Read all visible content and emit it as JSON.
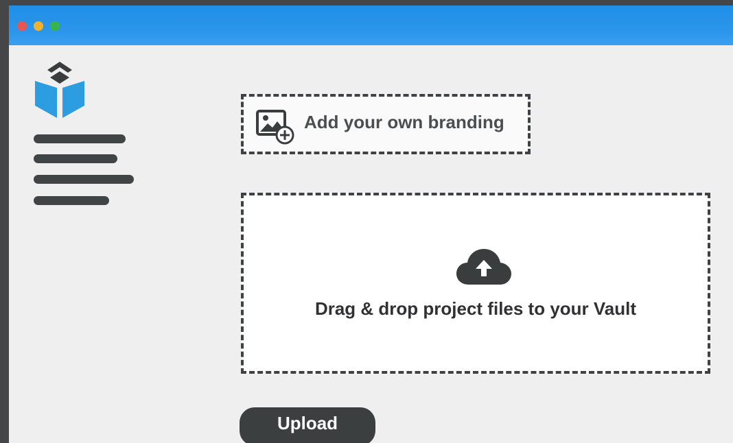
{
  "window": {
    "controls": [
      {
        "name": "close",
        "color": "#e8574f"
      },
      {
        "name": "minimize",
        "color": "#f3b12c"
      },
      {
        "name": "maximize",
        "color": "#38b54a"
      }
    ],
    "titlebar_color": "#2a95ea"
  },
  "sidebar": {
    "logo_icon": "cube-logo-icon",
    "logo_colors": {
      "primary": "#2b9de0",
      "dark": "#3a3d3e"
    },
    "menu_icon": "text-lines-icon"
  },
  "branding": {
    "label": "Add your own branding",
    "icon": "add-image-icon"
  },
  "dropzone": {
    "label": "Drag & drop project files to your Vault",
    "icon": "cloud-upload-icon"
  },
  "actions": {
    "upload_label": "Upload"
  },
  "colors": {
    "dark": "#3c3f40",
    "background": "#efeff0"
  }
}
